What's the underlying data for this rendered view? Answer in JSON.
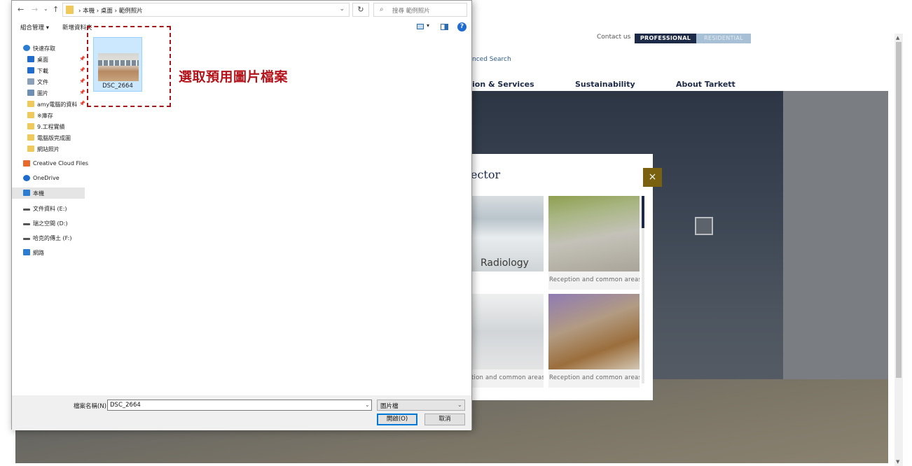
{
  "website": {
    "top_links": {
      "contact": "Contact us",
      "professional": "PROFESSIONAL",
      "residential": "RESIDENTIAL"
    },
    "advanced_search": "nced Search",
    "nav": [
      "ion & Services",
      "Sustainability",
      "About Tarkett"
    ],
    "modal": {
      "title": "ector",
      "close": "×",
      "tiles": [
        {
          "overlay": "Radiology",
          "caption": ""
        },
        {
          "overlay": "",
          "caption": "Reception and common areas"
        },
        {
          "overlay": "",
          "caption": "tion and common areas"
        },
        {
          "overlay": "",
          "caption": "Reception and common areas"
        }
      ]
    }
  },
  "dialog": {
    "nav_back": "←",
    "nav_forward": "→",
    "nav_recent": "⌄",
    "nav_up": "↑",
    "breadcrumb": "› 本機 › 桌面 › 範例照片",
    "address_dropdown": "⌄",
    "refresh": "↻",
    "search_placeholder": "搜尋 範例照片",
    "toolbar": {
      "organize": "組合管理 ▾",
      "new_folder": "新增資料夾",
      "view_dropdown": "▾",
      "help": "?"
    },
    "sidebar": [
      {
        "label": "快速存取",
        "icon": "star-icon",
        "color": "#2b7cd3",
        "pinned": false
      },
      {
        "label": "桌面",
        "icon": "desktop-icon",
        "color": "#1f6cd1",
        "pinned": true
      },
      {
        "label": "下載",
        "icon": "download-icon",
        "color": "#1f6cd1",
        "pinned": true
      },
      {
        "label": "文件",
        "icon": "document-icon",
        "color": "#8aa0b8",
        "pinned": true
      },
      {
        "label": "圖片",
        "icon": "pictures-icon",
        "color": "#6d8fb3",
        "pinned": true
      },
      {
        "label": "amy電腦的資料",
        "icon": "folder-icon",
        "color": "#f0c95a",
        "pinned": true
      },
      {
        "label": "※庫存",
        "icon": "folder-icon",
        "color": "#f0c95a",
        "pinned": false
      },
      {
        "label": "9.工程實績",
        "icon": "folder-icon",
        "color": "#f0c95a",
        "pinned": false
      },
      {
        "label": "電腦版完成圖",
        "icon": "folder-icon",
        "color": "#f0c95a",
        "pinned": false
      },
      {
        "label": "網站照片",
        "icon": "folder-icon",
        "color": "#f0c95a",
        "pinned": false
      },
      {
        "label": "Creative Cloud Files",
        "icon": "creative-cloud-icon",
        "color": "#e8692b",
        "pinned": false
      },
      {
        "label": "OneDrive",
        "icon": "onedrive-icon",
        "color": "#1f6cd1",
        "pinned": false
      },
      {
        "label": "本機",
        "icon": "this-pc-icon",
        "color": "#2b7cd3",
        "pinned": false,
        "selected": true
      },
      {
        "label": "文件資料 (E:)",
        "icon": "drive-icon",
        "color": "#555555",
        "pinned": false
      },
      {
        "label": "瑞之空間 (D:)",
        "icon": "drive-icon",
        "color": "#555555",
        "pinned": false
      },
      {
        "label": "哈克的傳土 (F:)",
        "icon": "drive-icon",
        "color": "#555555",
        "pinned": false
      },
      {
        "label": "網路",
        "icon": "network-icon",
        "color": "#2b7cd3",
        "pinned": false
      }
    ],
    "file": {
      "name": "DSC_2664"
    },
    "annotation": "選取預用圖片檔案",
    "filename_label": "檔案名稱(N):",
    "filename_value": "DSC_2664",
    "filename_dropdown": "⌄",
    "filetype": "圖片檔",
    "filetype_dropdown": "⌄",
    "open_button": "開啟(O)",
    "cancel_button": "取消"
  },
  "colors": {
    "annotation": "#b3141b",
    "professional": "#1d2a48",
    "close_button": "#7a6110",
    "selection": "#cce8ff"
  }
}
